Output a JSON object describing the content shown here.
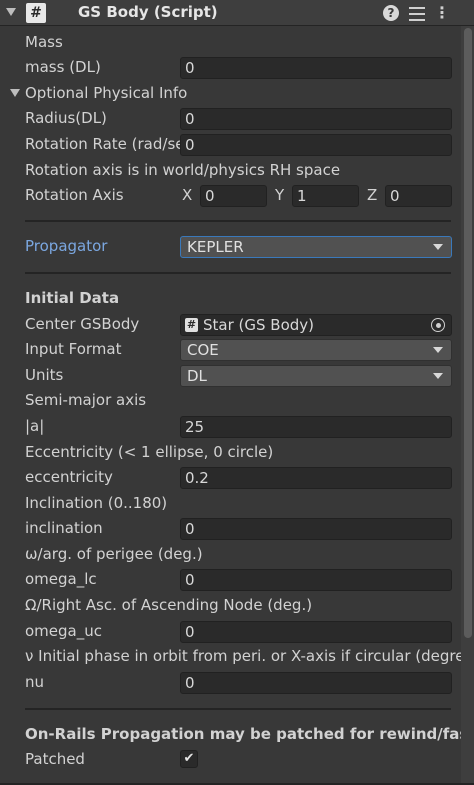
{
  "header": {
    "title": "GS Body (Script)",
    "icon": "#",
    "help": "?",
    "menu": "⋮"
  },
  "fields": {
    "mass_heading": "Mass",
    "mass_label": "mass (DL)",
    "mass_value": "0",
    "optional_foldout": "Optional Physical Info",
    "radius_label": "Radius(DL)",
    "radius_value": "0",
    "rotation_rate_label": "Rotation Rate (rad/sec)",
    "rotation_rate_value": "0",
    "rotation_axis_note": "Rotation axis is in world/physics RH space",
    "rotation_axis_label": "Rotation Axis",
    "rot_x_label": "X",
    "rot_x_value": "0",
    "rot_y_label": "Y",
    "rot_y_value": "1",
    "rot_z_label": "Z",
    "rot_z_value": "0",
    "propagator_label": "Propagator",
    "propagator_value": "KEPLER",
    "initial_data_heading": "Initial Data",
    "center_label": "Center GSBody",
    "center_value": "Star (GS Body)",
    "input_format_label": "Input Format",
    "input_format_value": "COE",
    "units_label": "Units",
    "units_value": "DL",
    "sma_heading": "Semi-major axis",
    "sma_label": "|a|",
    "sma_value": "25",
    "ecc_heading": "Eccentricity (< 1 ellipse, 0 circle)",
    "ecc_label": "eccentricity",
    "ecc_value": "0.2",
    "inc_heading": "Inclination (0..180)",
    "inc_label": "inclination",
    "inc_value": "0",
    "omega_lc_heading": "ω/arg. of perigee (deg.)",
    "omega_lc_label": "omega_lc",
    "omega_lc_value": "0",
    "omega_uc_heading": "Ω/Right Asc. of Ascending Node (deg.)",
    "omega_uc_label": "omega_uc",
    "omega_uc_value": "0",
    "nu_heading": "ν Initial phase in orbit from peri. or X-axis if circular (degrees)",
    "nu_label": "nu",
    "nu_value": "0",
    "onrails_heading": "On-Rails Propagation may be patched for rewind/fast-fwd",
    "patched_label": "Patched",
    "patched_checked": true,
    "check_glyph": "✔"
  },
  "colors": {
    "background": "#383838",
    "field": "#2a2a2a",
    "accent_label": "#7ba7e0",
    "focus_border": "#3a79bb"
  }
}
